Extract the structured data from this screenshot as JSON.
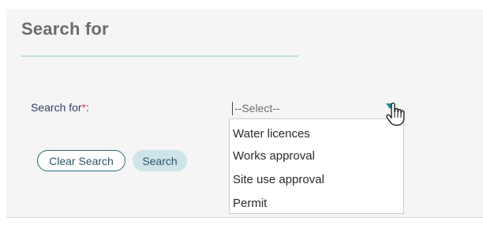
{
  "panel": {
    "title": "Search for"
  },
  "form": {
    "search_for_label": "Search for",
    "required_marker": "*",
    "label_suffix": ":",
    "select": {
      "selected_value": "--Select--",
      "options": [
        "Water licences",
        "Works approval",
        "Site use approval",
        "Permit"
      ]
    }
  },
  "buttons": {
    "clear_label": "Clear Search",
    "search_label": "Search"
  },
  "icons": {
    "dropdown_arrow": "caret-down",
    "cursor": "hand-pointer"
  },
  "colors": {
    "accent": "#1f8e96",
    "label_text": "#2d3e6a",
    "required": "#e0403f",
    "search_button_bg": "#cde5ea"
  }
}
